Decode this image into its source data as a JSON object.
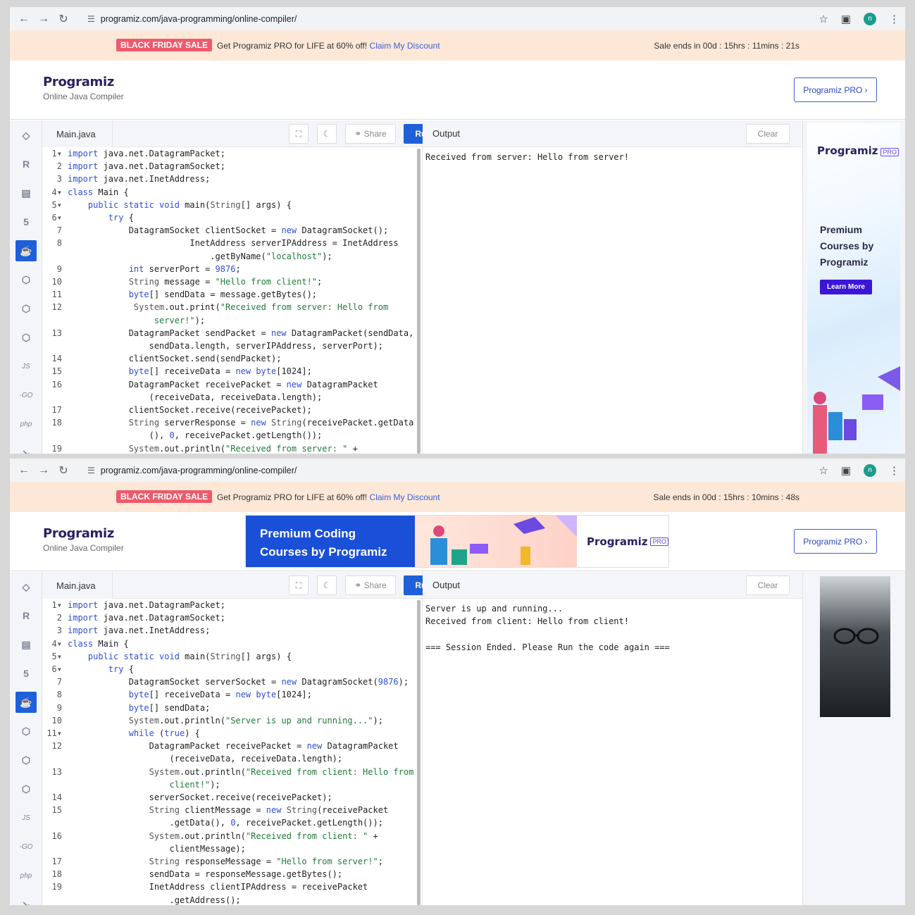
{
  "windows": [
    {
      "url": "programiz.com/java-programming/online-compiler/",
      "banner": {
        "badge": "BLACK FRIDAY SALE",
        "text": "Get Programiz PRO for LIFE at 60% off!",
        "link": "Claim My Discount",
        "timer": "Sale ends in 00d : 15hrs : 11mins : 21s"
      },
      "logo": {
        "name": "Programiz",
        "subtitle": "Online Java Compiler"
      },
      "pro_button": "Programiz PRO ›",
      "tab": "Main.java",
      "share": "Share",
      "run": "Run",
      "output_label": "Output",
      "clear": "Clear",
      "output_text": "Received from server: Hello from server!",
      "ad": {
        "logo": "Programiz",
        "pro": "PRO",
        "text": "Premium Courses by Programiz",
        "button": "Learn More"
      }
    },
    {
      "url": "programiz.com/java-programming/online-compiler/",
      "banner": {
        "badge": "BLACK FRIDAY SALE",
        "text": "Get Programiz PRO for LIFE at 60% off!",
        "link": "Claim My Discount",
        "timer": "Sale ends in 00d : 15hrs : 10mins : 48s"
      },
      "logo": {
        "name": "Programiz",
        "subtitle": "Online Java Compiler"
      },
      "header_ad": {
        "text1": "Premium Coding",
        "text2": "Courses by Programiz",
        "logo": "Programiz",
        "pro": "PRO"
      },
      "pro_button": "Programiz PRO ›",
      "tab": "Main.java",
      "share": "Share",
      "run": "Run",
      "output_label": "Output",
      "clear": "Clear",
      "output_text": "Server is up and running...\nReceived from client: Hello from client!\n\n=== Session Ended. Please Run the code again ==="
    }
  ],
  "sidebar_icons": [
    "python-icon",
    "r-icon",
    "sql-icon",
    "html-icon",
    "java-icon",
    "c-icon",
    "cpp-icon",
    "csharp-icon",
    "js-icon",
    "go-icon",
    "php-icon",
    "swift-icon"
  ],
  "sidebar_labels": {
    "js": "JS",
    "go": "-GO",
    "php": "php"
  },
  "code1": [
    {
      "n": "1",
      "f": "▾",
      "s": "<span class=\"kw\">import</span> java.net.DatagramPacket;"
    },
    {
      "n": "2",
      "s": "<span class=\"kw\">import</span> java.net.DatagramSocket;"
    },
    {
      "n": "3",
      "s": "<span class=\"kw\">import</span> java.net.InetAddress;"
    },
    {
      "n": "4",
      "f": "▾",
      "s": "<span class=\"kw\">class</span> Main {"
    },
    {
      "n": "5",
      "f": "▾",
      "s": "    <span class=\"kw\">public static void</span> main(<span class=\"ty\">String</span>[] args) {"
    },
    {
      "n": "6",
      "f": "▾",
      "s": "        <span class=\"kw\">try</span> {"
    },
    {
      "n": "7",
      "s": "            DatagramSocket clientSocket = <span class=\"kw\">new</span> DatagramSocket();"
    },
    {
      "n": "8",
      "s": "                        InetAddress serverIPAddress = InetAddress"
    },
    {
      "n": "",
      "s": "                            .getByName(<span class=\"str\">\"localhost\"</span>);"
    },
    {
      "n": "9",
      "s": "            <span class=\"kw\">int</span> serverPort = <span class=\"kw\">9876</span>;"
    },
    {
      "n": "10",
      "s": "            <span class=\"ty\">String</span> message = <span class=\"str\">\"Hello from client!\"</span>;"
    },
    {
      "n": "11",
      "s": "            <span class=\"kw\">byte</span>[] sendData = message.getBytes();"
    },
    {
      "n": "12",
      "s": "             <span class=\"ty\">System</span>.out.print(<span class=\"str\">\"Received from server: Hello from</span>"
    },
    {
      "n": "",
      "s": "<span class=\"str\">                 server!\"</span>);"
    },
    {
      "n": "13",
      "s": "            DatagramPacket sendPacket = <span class=\"kw\">new</span> DatagramPacket(sendData,"
    },
    {
      "n": "",
      "s": "                sendData.length, serverIPAddress, serverPort);"
    },
    {
      "n": "14",
      "s": "            clientSocket.send(sendPacket);"
    },
    {
      "n": "15",
      "s": "            <span class=\"kw\">byte</span>[] receiveData = <span class=\"kw\">new byte</span>[1024];"
    },
    {
      "n": "16",
      "s": "            DatagramPacket receivePacket = <span class=\"kw\">new</span> DatagramPacket"
    },
    {
      "n": "",
      "s": "                (receiveData, receiveData.length);"
    },
    {
      "n": "17",
      "s": "            clientSocket.receive(receivePacket);"
    },
    {
      "n": "18",
      "s": "            <span class=\"ty\">String</span> serverResponse = <span class=\"kw\">new</span> <span class=\"ty\">String</span>(receivePacket.getData"
    },
    {
      "n": "",
      "s": "                (), <span class=\"kw\">0</span>, receivePacket.getLength());"
    },
    {
      "n": "19",
      "s": "            <span class=\"ty\">System</span>.out.println(<span class=\"str\">\"Received from server: \"</span> +"
    }
  ],
  "code2": [
    {
      "n": "1",
      "f": "▾",
      "s": "<span class=\"kw\">import</span> java.net.DatagramPacket;"
    },
    {
      "n": "2",
      "s": "<span class=\"kw\">import</span> java.net.DatagramSocket;"
    },
    {
      "n": "3",
      "s": "<span class=\"kw\">import</span> java.net.InetAddress;"
    },
    {
      "n": "4",
      "f": "▾",
      "s": "<span class=\"kw\">class</span> Main {"
    },
    {
      "n": "5",
      "f": "▾",
      "s": "    <span class=\"kw\">public static void</span> main(<span class=\"ty\">String</span>[] args) {"
    },
    {
      "n": "6",
      "f": "▾",
      "s": "        <span class=\"kw\">try</span> {"
    },
    {
      "n": "7",
      "s": "            DatagramSocket serverSocket = <span class=\"kw\">new</span> DatagramSocket(<span class=\"kw\">9876</span>);"
    },
    {
      "n": "8",
      "s": "            <span class=\"kw\">byte</span>[] receiveData = <span class=\"kw\">new byte</span>[1024];"
    },
    {
      "n": "9",
      "s": "            <span class=\"kw\">byte</span>[] sendData;"
    },
    {
      "n": "10",
      "s": "            <span class=\"ty\">System</span>.out.println(<span class=\"str\">\"Server is up and running...\"</span>);"
    },
    {
      "n": "11",
      "f": "▾",
      "s": "            <span class=\"kw\">while</span> (<span class=\"kw\">true</span>) {"
    },
    {
      "n": "12",
      "s": "                DatagramPacket receivePacket = <span class=\"kw\">new</span> DatagramPacket"
    },
    {
      "n": "",
      "s": "                    (receiveData, receiveData.length);"
    },
    {
      "n": "13",
      "s": "                <span class=\"ty\">System</span>.out.println(<span class=\"str\">\"Received from client: Hello from</span>"
    },
    {
      "n": "",
      "s": "<span class=\"str\">                    client!\"</span>);"
    },
    {
      "n": "14",
      "s": "                serverSocket.receive(receivePacket);"
    },
    {
      "n": "15",
      "s": "                <span class=\"ty\">String</span> clientMessage = <span class=\"kw\">new</span> <span class=\"ty\">String</span>(receivePacket"
    },
    {
      "n": "",
      "s": "                    .getData(), <span class=\"kw\">0</span>, receivePacket.getLength());"
    },
    {
      "n": "16",
      "s": "                <span class=\"ty\">System</span>.out.println(<span class=\"str\">\"Received from client: \"</span> +"
    },
    {
      "n": "",
      "s": "                    clientMessage);"
    },
    {
      "n": "17",
      "s": "                <span class=\"ty\">String</span> responseMessage = <span class=\"str\">\"Hello from server!\"</span>;"
    },
    {
      "n": "18",
      "s": "                sendData = responseMessage.getBytes();"
    },
    {
      "n": "19",
      "s": "                InetAddress clientIPAddress = receivePacket"
    },
    {
      "n": "",
      "s": "                    .getAddress();"
    }
  ]
}
